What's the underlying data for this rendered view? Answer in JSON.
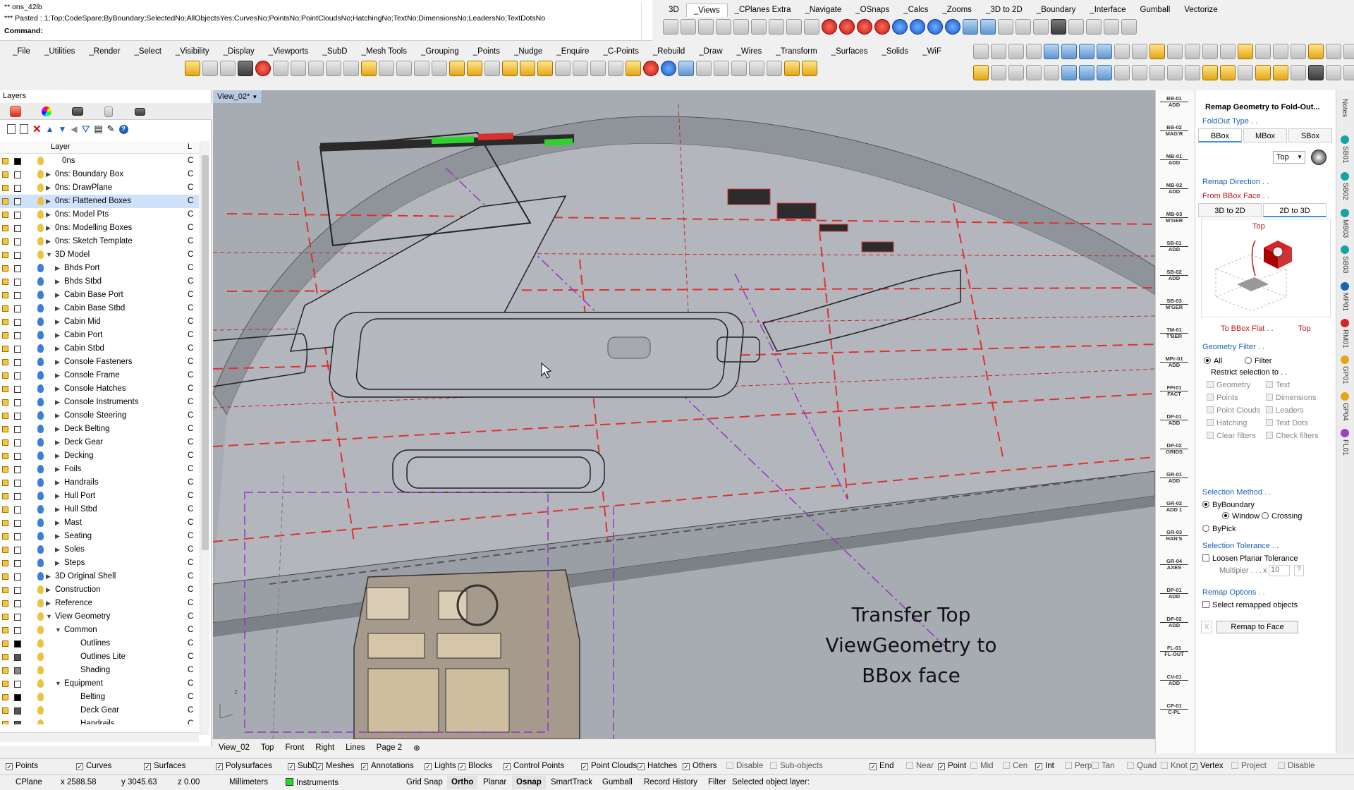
{
  "command": {
    "history_1": "** ons_42lb",
    "history_2": "*** Pasted : 1;Top;CodeSpare;ByBoundary;SelectedNo;AllObjectsYes;CurvesNo;PointsNo;PointCloudsNo;HatchingNo;TextNo;DimensionsNo;LeadersNo;TextDotsNo",
    "prompt": "Command:"
  },
  "top_tabs": [
    "3D",
    "_Views",
    "_CPlanes Extra",
    "_Navigate",
    "_OSnaps",
    "_Calcs",
    "_Zooms",
    "_3D to 2D",
    "_Boundary",
    "_Interface",
    "Gumball",
    "Vectorize"
  ],
  "main_tabs": [
    "_File",
    "_Utilities",
    "_Render",
    "_Select",
    "_Visibility",
    "_Display",
    "_Viewports",
    "_SubD",
    "_Mesh Tools",
    "_Grouping",
    "_Points",
    "_Nudge",
    "_Enquire",
    "_C-Points",
    "_Rebuild",
    "_Draw",
    "_Wires",
    "_Transform",
    "_Surfaces",
    "_Solids",
    "_WiF"
  ],
  "layers": {
    "title": "Layers",
    "col_layer": "Layer",
    "col_l": "L",
    "items": [
      {
        "name": "0ns",
        "indent": 0,
        "tw": "",
        "color": "#000000",
        "bulb": "#e8c440",
        "sel": false
      },
      {
        "name": "0ns: Boundary Box",
        "indent": 0,
        "tw": ">",
        "color": "#ffffff",
        "bulb": "#e8c440",
        "sel": false
      },
      {
        "name": "0ns: DrawPlane",
        "indent": 0,
        "tw": ">",
        "color": "#ffffff",
        "bulb": "#e8c440",
        "sel": false
      },
      {
        "name": "0ns: Flattened Boxes",
        "indent": 0,
        "tw": ">",
        "color": "#ffffff",
        "bulb": "#e8c440",
        "sel": true
      },
      {
        "name": "0ns: Model Pts",
        "indent": 0,
        "tw": ">",
        "color": "#ffffff",
        "bulb": "#e8c440",
        "sel": false
      },
      {
        "name": "0ns: Modelling Boxes",
        "indent": 0,
        "tw": ">",
        "color": "#ffffff",
        "bulb": "#e8c440",
        "sel": false
      },
      {
        "name": "0ns: Sketch Template",
        "indent": 0,
        "tw": ">",
        "color": "#ffffff",
        "bulb": "#e8c440",
        "sel": false
      },
      {
        "name": "3D Model",
        "indent": 0,
        "tw": "v",
        "color": "#ffffff",
        "bulb": "#e8c440",
        "sel": false
      },
      {
        "name": "Bhds Port",
        "indent": 1,
        "tw": ">",
        "color": "#ffffff",
        "bulb": "#3b7fd8",
        "sel": false
      },
      {
        "name": "Bhds Stbd",
        "indent": 1,
        "tw": ">",
        "color": "#ffffff",
        "bulb": "#3b7fd8",
        "sel": false
      },
      {
        "name": "Cabin Base Port",
        "indent": 1,
        "tw": ">",
        "color": "#ffffff",
        "bulb": "#3b7fd8",
        "sel": false
      },
      {
        "name": "Cabin Base Stbd",
        "indent": 1,
        "tw": ">",
        "color": "#ffffff",
        "bulb": "#3b7fd8",
        "sel": false
      },
      {
        "name": "Cabin Mid",
        "indent": 1,
        "tw": ">",
        "color": "#ffffff",
        "bulb": "#3b7fd8",
        "sel": false
      },
      {
        "name": "Cabin Port",
        "indent": 1,
        "tw": ">",
        "color": "#ffffff",
        "bulb": "#3b7fd8",
        "sel": false
      },
      {
        "name": "Cabin Stbd",
        "indent": 1,
        "tw": ">",
        "color": "#ffffff",
        "bulb": "#3b7fd8",
        "sel": false
      },
      {
        "name": "Console Fasteners",
        "indent": 1,
        "tw": ">",
        "color": "#ffffff",
        "bulb": "#3b7fd8",
        "sel": false
      },
      {
        "name": "Console Frame",
        "indent": 1,
        "tw": ">",
        "color": "#ffffff",
        "bulb": "#3b7fd8",
        "sel": false
      },
      {
        "name": "Console Hatches",
        "indent": 1,
        "tw": ">",
        "color": "#ffffff",
        "bulb": "#3b7fd8",
        "sel": false
      },
      {
        "name": "Console Instruments",
        "indent": 1,
        "tw": ">",
        "color": "#ffffff",
        "bulb": "#3b7fd8",
        "sel": false
      },
      {
        "name": "Console Steering",
        "indent": 1,
        "tw": ">",
        "color": "#ffffff",
        "bulb": "#3b7fd8",
        "sel": false
      },
      {
        "name": "Deck Belting",
        "indent": 1,
        "tw": ">",
        "color": "#ffffff",
        "bulb": "#3b7fd8",
        "sel": false
      },
      {
        "name": "Deck Gear",
        "indent": 1,
        "tw": ">",
        "color": "#ffffff",
        "bulb": "#3b7fd8",
        "sel": false
      },
      {
        "name": "Decking",
        "indent": 1,
        "tw": ">",
        "color": "#ffffff",
        "bulb": "#3b7fd8",
        "sel": false
      },
      {
        "name": "Foils",
        "indent": 1,
        "tw": ">",
        "color": "#ffffff",
        "bulb": "#3b7fd8",
        "sel": false
      },
      {
        "name": "Handrails",
        "indent": 1,
        "tw": ">",
        "color": "#ffffff",
        "bulb": "#3b7fd8",
        "sel": false
      },
      {
        "name": "Hull Port",
        "indent": 1,
        "tw": ">",
        "color": "#ffffff",
        "bulb": "#3b7fd8",
        "sel": false
      },
      {
        "name": "Hull Stbd",
        "indent": 1,
        "tw": ">",
        "color": "#ffffff",
        "bulb": "#3b7fd8",
        "sel": false
      },
      {
        "name": "Mast",
        "indent": 1,
        "tw": ">",
        "color": "#ffffff",
        "bulb": "#3b7fd8",
        "sel": false
      },
      {
        "name": "Seating",
        "indent": 1,
        "tw": ">",
        "color": "#ffffff",
        "bulb": "#3b7fd8",
        "sel": false
      },
      {
        "name": "Soles",
        "indent": 1,
        "tw": ">",
        "color": "#ffffff",
        "bulb": "#3b7fd8",
        "sel": false
      },
      {
        "name": "Steps",
        "indent": 1,
        "tw": ">",
        "color": "#ffffff",
        "bulb": "#3b7fd8",
        "sel": false
      },
      {
        "name": "3D Original Shell",
        "indent": 0,
        "tw": ">",
        "color": "#ffffff",
        "bulb": "#3b7fd8",
        "sel": false
      },
      {
        "name": "Construction",
        "indent": 0,
        "tw": ">",
        "color": "#ffffff",
        "bulb": "#e8c440",
        "sel": false
      },
      {
        "name": "Reference",
        "indent": 0,
        "tw": ">",
        "color": "#ffffff",
        "bulb": "#e8c440",
        "sel": false
      },
      {
        "name": "View Geometry",
        "indent": 0,
        "tw": "v",
        "color": "#ffffff",
        "bulb": "#e8c440",
        "sel": false
      },
      {
        "name": "Common",
        "indent": 1,
        "tw": "v",
        "color": "#ffffff",
        "bulb": "#e8c440",
        "sel": false
      },
      {
        "name": "Outlines",
        "indent": 2,
        "tw": "",
        "color": "#000000",
        "bulb": "#e8c440",
        "sel": false
      },
      {
        "name": "Outlines Lite",
        "indent": 2,
        "tw": "",
        "color": "#555555",
        "bulb": "#e8c440",
        "sel": false
      },
      {
        "name": "Shading",
        "indent": 2,
        "tw": "",
        "color": "#888888",
        "bulb": "#e8c440",
        "sel": false
      },
      {
        "name": "Equipment",
        "indent": 1,
        "tw": "v",
        "color": "#ffffff",
        "bulb": "#e8c440",
        "sel": false
      },
      {
        "name": "Belting",
        "indent": 2,
        "tw": "",
        "color": "#000000",
        "bulb": "#e8c440",
        "sel": false
      },
      {
        "name": "Deck Gear",
        "indent": 2,
        "tw": "",
        "color": "#555555",
        "bulb": "#e8c440",
        "sel": false
      },
      {
        "name": "Handrails",
        "indent": 2,
        "tw": "",
        "color": "#555555",
        "bulb": "#e8c440",
        "sel": false
      }
    ],
    "c_char": "C"
  },
  "viewport": {
    "tab_label": "View_02*",
    "annotation_1": "Transfer Top",
    "annotation_2": "ViewGeometry to",
    "annotation_3": "BBox face",
    "bottom_tabs": [
      "View_02",
      "Top",
      "Front",
      "Right",
      "Lines",
      "Page 2"
    ]
  },
  "right_strip": [
    {
      "l1": "BB-01",
      "l2": "ADD"
    },
    {
      "l1": "BB-02",
      "l2": "MAG'R"
    },
    {
      "l1": "MB-01",
      "l2": "ADD"
    },
    {
      "l1": "MB-02",
      "l2": "ADD"
    },
    {
      "l1": "MB-03",
      "l2": "M'GER"
    },
    {
      "l1": "SB-01",
      "l2": "ADD"
    },
    {
      "l1": "SB-02",
      "l2": "ADD"
    },
    {
      "l1": "SB-03",
      "l2": "M'GER"
    },
    {
      "l1": "TM-01",
      "l2": "T'BER"
    },
    {
      "l1": "MPr-01",
      "l2": "ADD"
    },
    {
      "l1": "FPr01",
      "l2": "FACT"
    },
    {
      "l1": "DP-01",
      "l2": "ADD"
    },
    {
      "l1": "DP-02",
      "l2": "GRIDS"
    },
    {
      "l1": "GR-01",
      "l2": "ADD"
    },
    {
      "l1": "GR-02",
      "l2": "ADD 1"
    },
    {
      "l1": "GR-03",
      "l2": "HAN'S"
    },
    {
      "l1": "GR-04",
      "l2": "AXES"
    },
    {
      "l1": "DP-01",
      "l2": "ADD"
    },
    {
      "l1": "DP-02",
      "l2": "ADD"
    },
    {
      "l1": "FL-01",
      "l2": "FL-OUT"
    },
    {
      "l1": "CV-01",
      "l2": "ADD"
    },
    {
      "l1": "CP-01",
      "l2": "C-PL"
    }
  ],
  "remap": {
    "title": "Remap Geometry to Fold-Out...",
    "foldout_type": "FoldOut Type . .",
    "tabs": [
      "BBox",
      "MBox",
      "SBox"
    ],
    "view_select": "Top",
    "direction_label": "Remap Direction . .",
    "from_face": "From BBox Face . .",
    "dir_tabs": [
      "3D to 2D",
      "2D to 3D"
    ],
    "top_label": "Top",
    "to_flat": "To BBox Flat . .",
    "to_flat_value": "Top",
    "geom_filter": "Geometry Filter . .",
    "all": "All",
    "filter": "Filter",
    "restrict": "Restrict selection to . .",
    "filters": [
      "Geometry",
      "Text",
      "Points",
      "Dimensions",
      "Point Clouds",
      "Leaders",
      "Hatching",
      "Text Dots",
      "Clear filters",
      "Check filters"
    ],
    "sel_method": "Selection Method . .",
    "byboundary": "ByBoundary",
    "window": "Window",
    "crossing": "Crossing",
    "bypick": "ByPick",
    "sel_tol": "Selection Tolerance . .",
    "loosen": "Loosen Planar Tolerance",
    "multiplier": "Multipier . . .",
    "mult_x": "x",
    "mult_val": "10",
    "q": "?",
    "remap_opts": "Remap Options . .",
    "select_remapped": "Select remapped objects",
    "x_btn": "X",
    "remap_btn": "Remap to Face"
  },
  "vert_tabs": [
    {
      "label": "Notes",
      "color": ""
    },
    {
      "label": "SB01",
      "color": "#16a3a3"
    },
    {
      "label": "SB02",
      "color": "#16a3a3"
    },
    {
      "label": "MB03",
      "color": "#16a3a3"
    },
    {
      "label": "SB03",
      "color": "#16a3a3"
    },
    {
      "label": "MP01",
      "color": "#1a64b8"
    },
    {
      "label": "RM01",
      "color": "#d22"
    },
    {
      "label": "GP01",
      "color": "#e3a616"
    },
    {
      "label": "GP04",
      "color": "#e3a616"
    },
    {
      "label": "FL01",
      "color": "#a040c0"
    }
  ],
  "filters_bar": {
    "items": [
      {
        "label": "Points",
        "on": true
      },
      {
        "label": "Curves",
        "on": true
      },
      {
        "label": "Surfaces",
        "on": true
      },
      {
        "label": "Polysurfaces",
        "on": true
      },
      {
        "label": "SubDs",
        "on": true
      },
      {
        "label": "Meshes",
        "on": true
      },
      {
        "label": "Annotations",
        "on": true
      },
      {
        "label": "Lights",
        "on": true
      },
      {
        "label": "Blocks",
        "on": true
      },
      {
        "label": "Control Points",
        "on": true
      },
      {
        "label": "Point Clouds",
        "on": true
      },
      {
        "label": "Hatches",
        "on": true
      },
      {
        "label": "Others",
        "on": true
      },
      {
        "label": "Disable",
        "on": false
      },
      {
        "label": "Sub-objects",
        "on": false
      }
    ],
    "snaps": [
      {
        "label": "End",
        "on": true
      },
      {
        "label": "Near",
        "on": false
      },
      {
        "label": "Point",
        "on": true
      },
      {
        "label": "Mid",
        "on": false
      },
      {
        "label": "Cen",
        "on": false
      },
      {
        "label": "Int",
        "on": true
      },
      {
        "label": "Perp",
        "on": false
      },
      {
        "label": "Tan",
        "on": false
      },
      {
        "label": "Quad",
        "on": false
      },
      {
        "label": "Knot",
        "on": false
      },
      {
        "label": "Vertex",
        "on": true
      },
      {
        "label": "Project",
        "on": false
      },
      {
        "label": "Disable",
        "on": false
      }
    ]
  },
  "status": {
    "cplane": "CPlane",
    "x": "x 2588.58",
    "y": "y 3045.63",
    "z": "z 0.00",
    "units": "Millimeters",
    "layer": "Instruments",
    "layer_color": "#22dd22",
    "grid_snap": "Grid Snap",
    "ortho": "Ortho",
    "planar": "Planar",
    "osnap": "Osnap",
    "smarttrack": "SmartTrack",
    "gumball": "Gumball",
    "record_history": "Record History",
    "filter": "Filter",
    "selected": "Selected object layer:"
  }
}
